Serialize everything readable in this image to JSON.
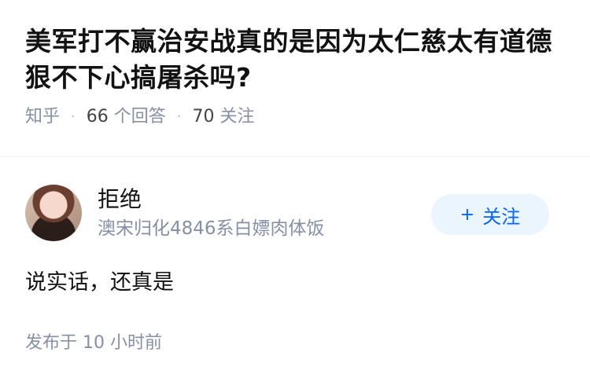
{
  "question": {
    "title": "美军打不赢治安战真的是因为太仁慈太有道德狠不下心搞屠杀吗?",
    "source": "知乎",
    "answers_count": "66",
    "answers_label": "个回答",
    "followers_count": "70",
    "followers_label": "关注"
  },
  "answer": {
    "author_name": "拒绝",
    "author_bio": "澳宋归化4846系白嫖肉体饭",
    "follow_label": "关注",
    "follow_icon": "plus-icon",
    "content": "说实话，还真是",
    "published_label": "发布于",
    "published_time": "10 小时前"
  },
  "colors": {
    "accent": "#0066ff",
    "follow_bg": "#ebf5fd",
    "meta_gray": "#8590a6"
  }
}
